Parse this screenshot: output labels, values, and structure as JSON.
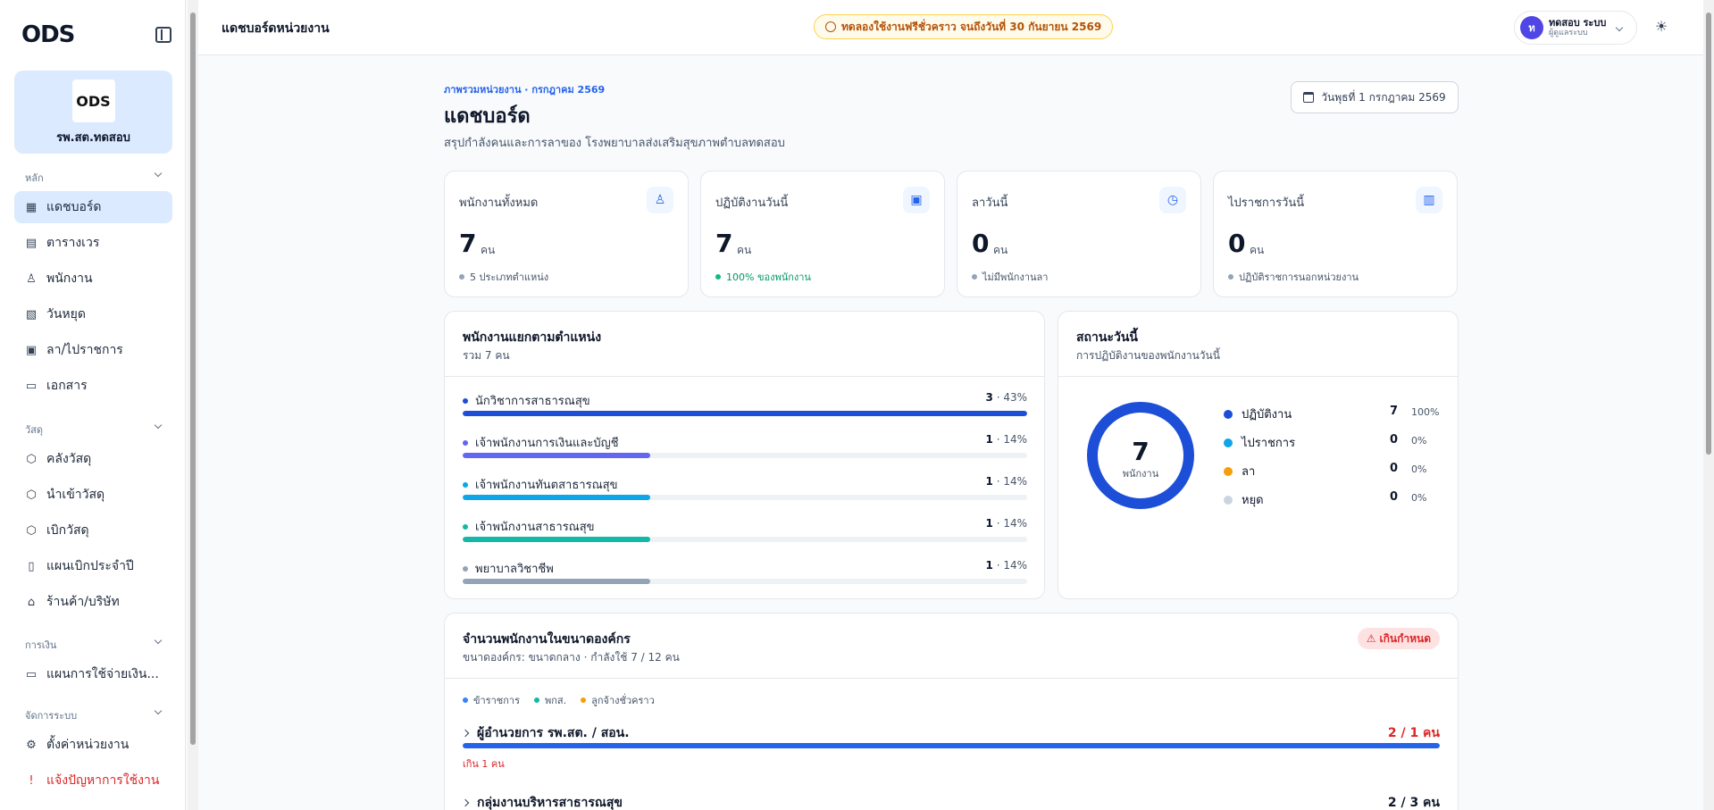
{
  "brand": {
    "logo_text": "ODS"
  },
  "org": {
    "logo_text": "ODS",
    "name": "รพ.สต.ทดสอบ"
  },
  "sidebar": {
    "sections": [
      {
        "label": "หลัก",
        "items": [
          {
            "label": "แดชบอร์ด",
            "icon": "dashboard-icon",
            "active": true
          },
          {
            "label": "ตารางเวร",
            "icon": "calendar-icon"
          },
          {
            "label": "พนักงาน",
            "icon": "users-icon"
          },
          {
            "label": "วันหยุด",
            "icon": "calendar-off-icon"
          },
          {
            "label": "ลา/ไปราชการ",
            "icon": "calendar-check-icon"
          },
          {
            "label": "เอกสาร",
            "icon": "document-icon"
          }
        ]
      },
      {
        "label": "วัสดุ",
        "items": [
          {
            "label": "คลังวัสดุ",
            "icon": "box-icon"
          },
          {
            "label": "นำเข้าวัสดุ",
            "icon": "box-in-icon"
          },
          {
            "label": "เบิกวัสดุ",
            "icon": "box-out-icon"
          },
          {
            "label": "แผนเบิกประจำปี",
            "icon": "clipboard-icon"
          },
          {
            "label": "ร้านค้า/บริษัท",
            "icon": "store-icon"
          }
        ]
      },
      {
        "label": "การเงิน",
        "items": [
          {
            "label": "แผนการใช้จ่ายเงิน...",
            "icon": "wallet-icon"
          }
        ]
      },
      {
        "label": "จัดการระบบ",
        "items": [
          {
            "label": "ตั้งค่าหน่วยงาน",
            "icon": "gear-icon"
          },
          {
            "label": "แจ้งปัญหาการใช้งาน",
            "icon": "alert-message-icon",
            "danger": true
          }
        ]
      }
    ]
  },
  "header": {
    "title": "แดชบอร์ดหน่วยงาน",
    "trial": "ทดลองใช้งานฟรีชั่วคราว จนถึงวันที่ 30 กันยายน 2569",
    "user": {
      "initial": "ท",
      "name": "ทดสอบ ระบบ",
      "role": "ผู้ดูแลระบบ"
    }
  },
  "main": {
    "breadcrumb": "ภาพรวมหน่วยงาน · กรกฎาคม 2569",
    "title": "แดชบอร์ด",
    "subtitle": "สรุปกำลังคนและการลาของ โรงพยาบาลส่งเสริมสุขภาพตำบลทดสอบ",
    "date": "วันพุธที่ 1 กรกฎาคม 2569"
  },
  "stats": [
    {
      "label": "พนักงานทั้งหมด",
      "value": "7",
      "unit": "คน",
      "note": "5 ประเภทตำแหน่ง",
      "icon": "users-icon",
      "green": false
    },
    {
      "label": "ปฏิบัติงานวันนี้",
      "value": "7",
      "unit": "คน",
      "note": "100% ของพนักงาน",
      "icon": "calendar-check-icon",
      "green": true
    },
    {
      "label": "ลาวันนี้",
      "value": "0",
      "unit": "คน",
      "note": "ไม่มีพนักงานลา",
      "icon": "calendar-clock-icon",
      "green": false
    },
    {
      "label": "ไปราชการวันนี้",
      "value": "0",
      "unit": "คน",
      "note": "ปฏิบัติราชการนอกหน่วยงาน",
      "icon": "briefcase-icon",
      "green": false
    }
  ],
  "positions": {
    "title": "พนักงานแยกตามตำแหน่ง",
    "subtitle": "รวม 7 คน",
    "items": [
      {
        "label": "นักวิชาการสาธารณสุข",
        "count": "3",
        "pct": " · 43%",
        "fraction": 1.0,
        "color": "#1d4ed8"
      },
      {
        "label": "เจ้าพนักงานการเงินและบัญชี",
        "count": "1",
        "pct": " · 14%",
        "fraction": 0.333,
        "color": "#6366f1"
      },
      {
        "label": "เจ้าพนักงานทันตสาธารณสุข",
        "count": "1",
        "pct": " · 14%",
        "fraction": 0.333,
        "color": "#0ea5e9"
      },
      {
        "label": "เจ้าพนักงานสาธารณสุข",
        "count": "1",
        "pct": " · 14%",
        "fraction": 0.333,
        "color": "#14b8a6"
      },
      {
        "label": "พยาบาลวิชาชีพ",
        "count": "1",
        "pct": " · 14%",
        "fraction": 0.333,
        "color": "#94a3b8"
      }
    ]
  },
  "status": {
    "title": "สถานะวันนี้",
    "subtitle": "การปฏิบัติงานของพนักงานวันนี้",
    "center_value": "7",
    "center_label": "พนักงาน",
    "items": [
      {
        "label": "ปฏิบัติงาน",
        "count": "7",
        "pct": "100%",
        "value": 7,
        "color": "#1d4ed8"
      },
      {
        "label": "ไปราชการ",
        "count": "0",
        "pct": "0%",
        "value": 0,
        "color": "#0ea5e9"
      },
      {
        "label": "ลา",
        "count": "0",
        "pct": "0%",
        "value": 0,
        "color": "#f59e0b"
      },
      {
        "label": "หยุด",
        "count": "0",
        "pct": "0%",
        "value": 0,
        "color": "#cbd5e1"
      }
    ]
  },
  "orgsize": {
    "title": "จำนวนพนักงานในขนาดองค์กร",
    "subtitle": "ขนาดองค์กร: ขนาดกลาง · กำลังใช้ 7 / 12 คน",
    "warn": "เกินกำหนด",
    "legend": [
      {
        "label": "ข้าราชการ",
        "color": "#3b82f6"
      },
      {
        "label": "พกส.",
        "color": "#14b8a6"
      },
      {
        "label": "ลูกจ้างชั่วคราว",
        "color": "#f59e0b"
      }
    ],
    "rows": [
      {
        "name": "ผู้อำนวยการ รพ.สต. / สอน.",
        "count": "2 / 1 คน",
        "over": true,
        "fill": 1.0,
        "note": "เกิน 1 คน",
        "color": "#2563eb"
      },
      {
        "name": "กลุ่มงานบริหารสาธารณสุข",
        "count": "2 / 3 คน",
        "over": false,
        "fill": 0.667,
        "note": "",
        "color": "#2563eb"
      }
    ]
  }
}
